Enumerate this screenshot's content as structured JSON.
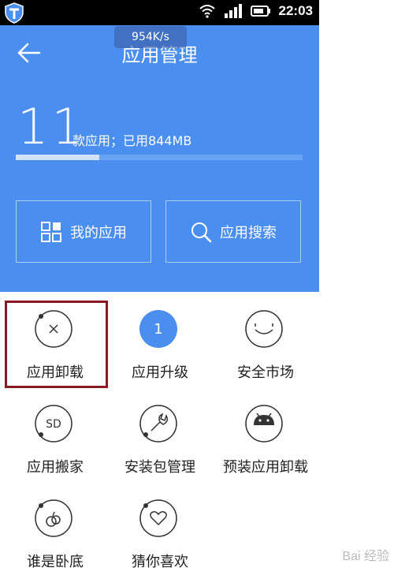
{
  "statusbar": {
    "time": "22:03",
    "net_speed": "954K/s"
  },
  "header": {
    "title": "应用管理",
    "app_count": "11",
    "usage_text": "款应用；已用844MB",
    "storage_used_fraction": 0.29,
    "my_apps_label": "我的应用",
    "search_label": "应用搜索"
  },
  "grid": {
    "uninstall": "应用卸载",
    "upgrade": "应用升级",
    "upgrade_badge": "1",
    "market": "安全市场",
    "move": "应用搬家",
    "package": "安装包管理",
    "preinstall": "预装应用卸载",
    "who_is": "谁是卧底",
    "guess": "猜你喜欢"
  },
  "watermark": "Bai 经验",
  "colors": {
    "header_blue": "#4a8ef0",
    "highlight": "#8a1a22"
  }
}
